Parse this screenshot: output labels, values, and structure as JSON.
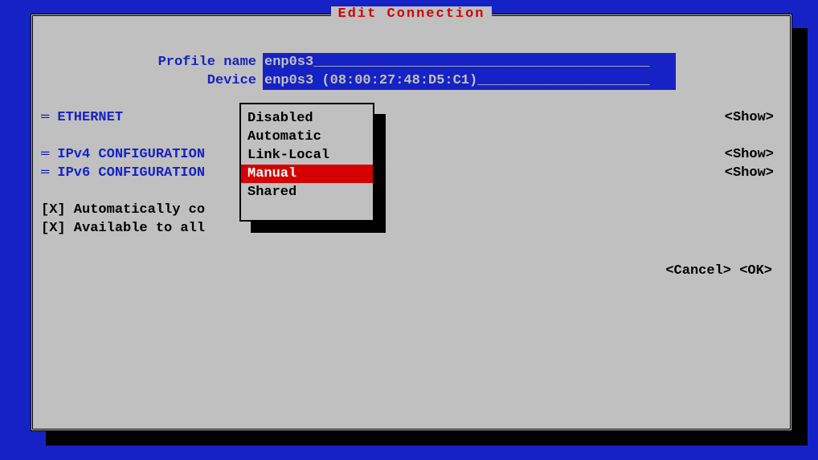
{
  "title": "Edit Connection",
  "form": {
    "profile_name_label": "Profile name",
    "profile_name_value": "enp0s3_________________________________________",
    "device_label": "Device",
    "device_value": "enp0s3 (08:00:27:48:D5:C1)_____________________"
  },
  "sections": {
    "ethernet": "ETHERNET",
    "ipv4": "IPv4 CONFIGURATION",
    "ipv6": "IPv6 CONFIGURATION"
  },
  "show_label": "<Show>",
  "checkboxes": {
    "auto_connect": "[X] Automatically co",
    "available_all": "[X] Available to all"
  },
  "buttons": {
    "cancel": "<Cancel>",
    "ok": "<OK>"
  },
  "popup": {
    "items": [
      {
        "label": "Disabled",
        "selected": false
      },
      {
        "label": "Automatic",
        "selected": false
      },
      {
        "label": "Link-Local",
        "selected": false
      },
      {
        "label": "Manual",
        "selected": true
      },
      {
        "label": "Shared",
        "selected": false
      }
    ]
  }
}
